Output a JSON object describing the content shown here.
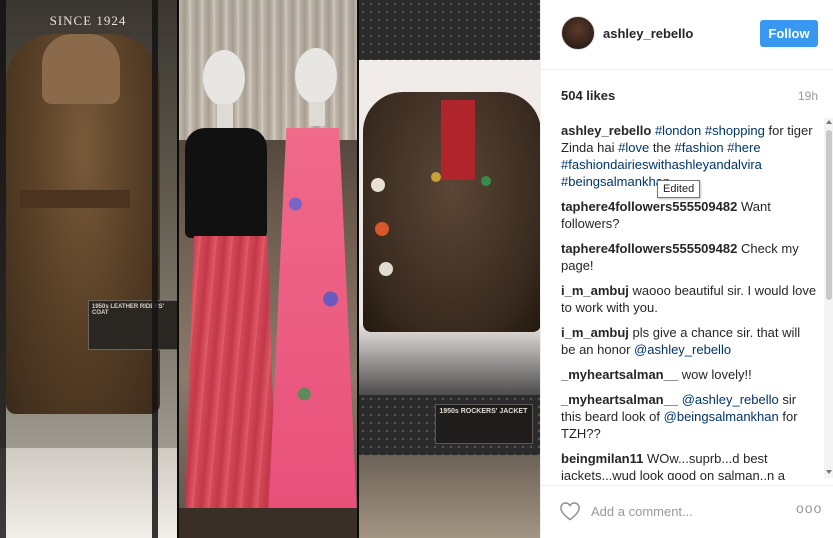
{
  "photo": {
    "panel1": {
      "sign": "SINCE 1924",
      "plaque_title": "1950s LEATHER RIDERS' COAT"
    },
    "panel3": {
      "plaque_title": "1950s ROCKERS' JACKET"
    }
  },
  "header": {
    "username": "ashley_rebello",
    "follow_label": "Follow",
    "avatar_icon": "avatar-photo"
  },
  "stats": {
    "likes": "504 likes",
    "time": "19h"
  },
  "caption": {
    "user": "ashley_rebello",
    "parts": [
      "#london",
      "#shopping",
      "for tiger Zinda hai",
      "#love",
      "the",
      "#fashion",
      "#here",
      "#fashiondairieswithashleyandalvira",
      "#beingsalmankhan"
    ]
  },
  "comments": [
    {
      "user": "taphere4followers555509482",
      "text": "Want followers?"
    },
    {
      "user": "taphere4followers555509482",
      "text": "Check my page!"
    },
    {
      "user": "i_m_ambuj",
      "text": "waooo beautiful sir. I would love to work with you."
    },
    {
      "user": "i_m_ambuj",
      "text": "pls give a chance sir. that will be an honor",
      "mention": "@ashley_rebello"
    },
    {
      "user": "_myheartsalman__",
      "text": "wow lovely!!"
    },
    {
      "user": "_myheartsalman__",
      "mention": "@ashley_rebello",
      "text": "sir this beard look of",
      "mention2": "@beingsalmankhan",
      "text2": "for TZH??"
    },
    {
      "user": "beingmilan11",
      "text": "WOw...suprb...d best jackets...wud look good on salman..n a small request plz give some variety coloured suits to salman other than full"
    }
  ],
  "tooltip": "Edited",
  "footer": {
    "heart_icon": "heart-outline",
    "placeholder": "Add a comment...",
    "more_label": "ooo"
  },
  "colors": {
    "accent": "#3897f0",
    "hashtag": "#003569",
    "muted": "#999999"
  }
}
